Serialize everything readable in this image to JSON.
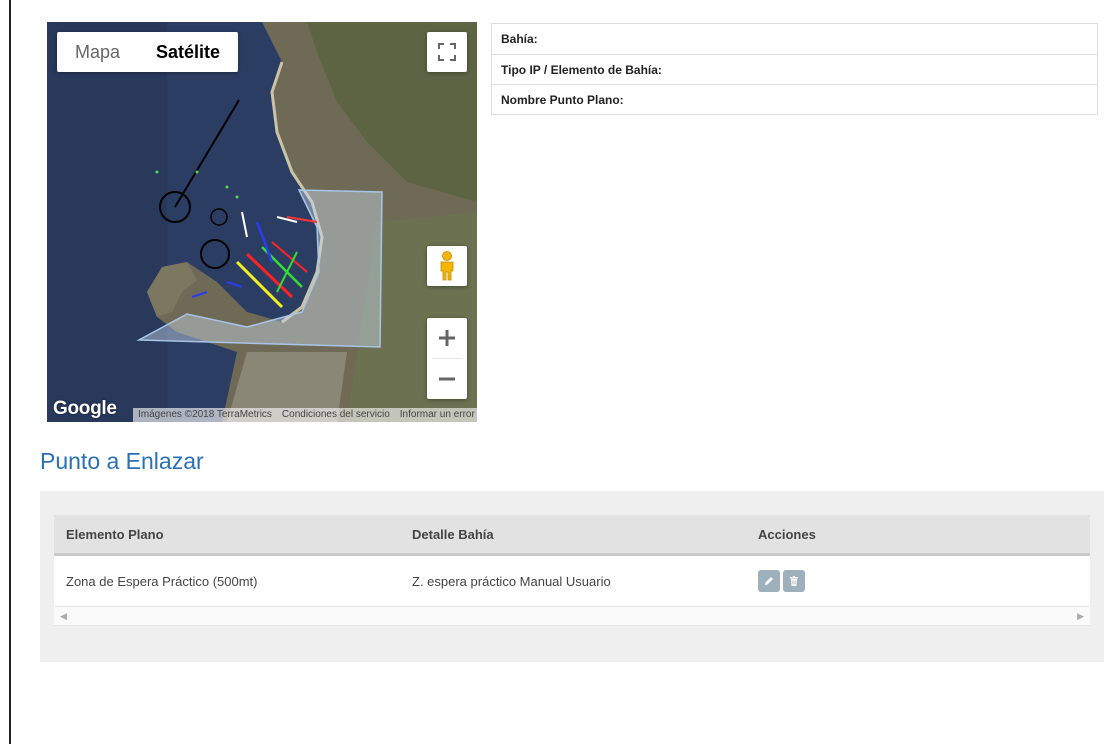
{
  "map": {
    "type_tabs": [
      {
        "label": "Mapa",
        "active": false
      },
      {
        "label": "Satélite",
        "active": true
      }
    ],
    "google_logo": "Google",
    "attribution": {
      "imagery": "Imágenes ©2018 TerraMetrics",
      "terms": "Condiciones del servicio",
      "report": "Informar un error en el mapa"
    },
    "controls": {
      "fullscreen_icon": "fullscreen-icon",
      "pegman_icon": "pegman-icon",
      "zoom_in": "+",
      "zoom_out": "−"
    }
  },
  "info": {
    "rows": [
      {
        "label": "Bahía:"
      },
      {
        "label": "Tipo IP / Elemento de Bahía:"
      },
      {
        "label": "Nombre Punto Plano:"
      }
    ]
  },
  "section": {
    "title": "Punto a Enlazar",
    "columns": [
      "Elemento Plano",
      "Detalle Bahía",
      "Acciones"
    ],
    "rows": [
      {
        "elemento": "Zona de Espera Práctico (500mt)",
        "detalle": "Z. espera práctico Manual Usuario",
        "actions": [
          "edit-icon",
          "trash-icon"
        ]
      }
    ]
  },
  "colors": {
    "accent": "#2b70b0",
    "action_button": "#9fb0bd",
    "panel_bg": "#efefef"
  }
}
